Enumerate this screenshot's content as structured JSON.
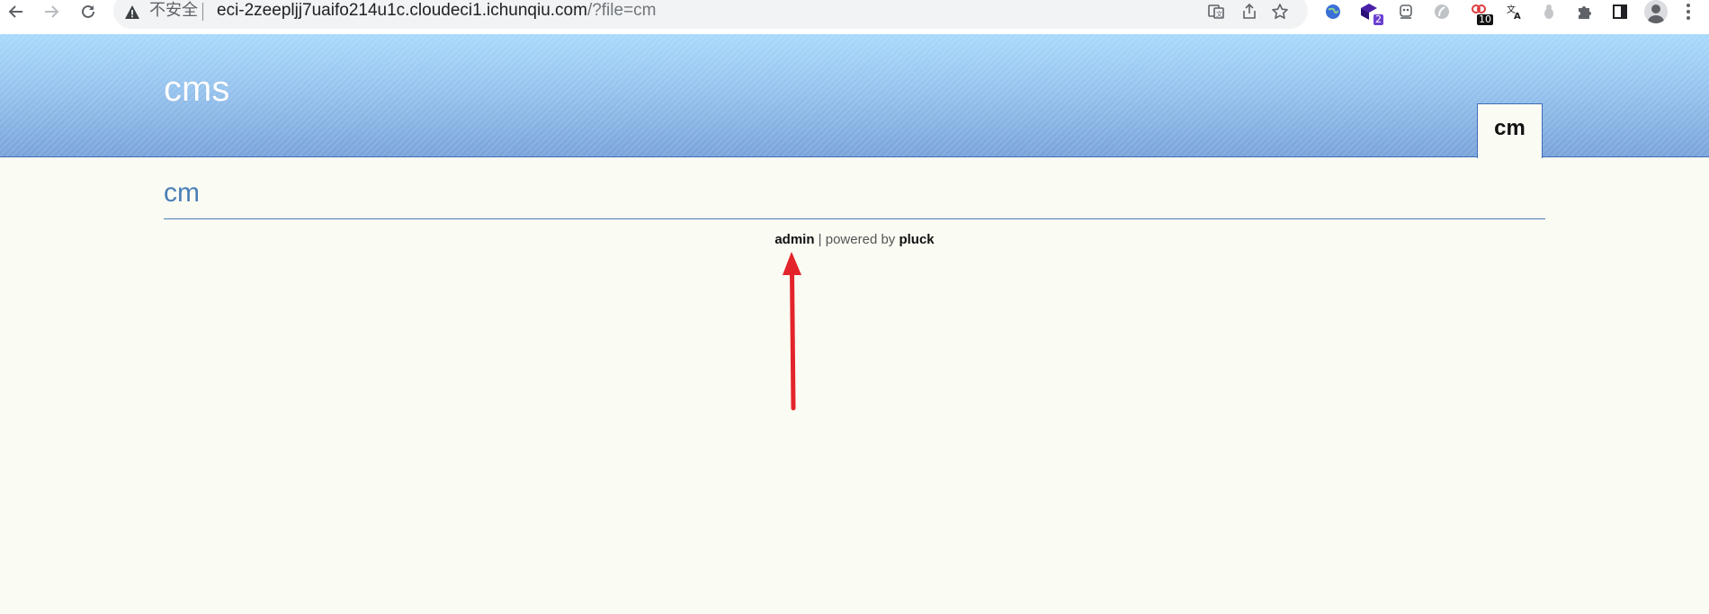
{
  "browser": {
    "security_label": "不安全",
    "url_host": "eci-2zeepljj7uaifo214u1c.cloudeci1.ichunqiu.com",
    "url_path": "/?file=cm",
    "extensions": [
      {
        "name": "globe-extension",
        "badge": ""
      },
      {
        "name": "purple-extension",
        "badge": "2",
        "badge_color": "#6b3fd1"
      },
      {
        "name": "ghost-extension",
        "badge": ""
      },
      {
        "name": "grey-extension",
        "badge": ""
      },
      {
        "name": "link-extension",
        "badge": "10",
        "badge_color": "#111111"
      },
      {
        "name": "translate-extension",
        "badge": ""
      },
      {
        "name": "puzzle-grey-extension",
        "badge": ""
      },
      {
        "name": "extensions-puzzle",
        "badge": ""
      },
      {
        "name": "side-panel",
        "badge": ""
      }
    ]
  },
  "site": {
    "title": "cms",
    "menu": [
      {
        "label": "cm",
        "active": true
      }
    ]
  },
  "content": {
    "heading": "cm"
  },
  "footer": {
    "admin_link": "admin",
    "separator_text": " | powered by ",
    "pluck_link": "pluck"
  },
  "colors": {
    "header_top": "#a9d9fb",
    "header_bottom": "#7aa3da",
    "page_bg": "#fafbf3",
    "heading": "#4a7fb6",
    "annotation_arrow": "#e3242b"
  }
}
